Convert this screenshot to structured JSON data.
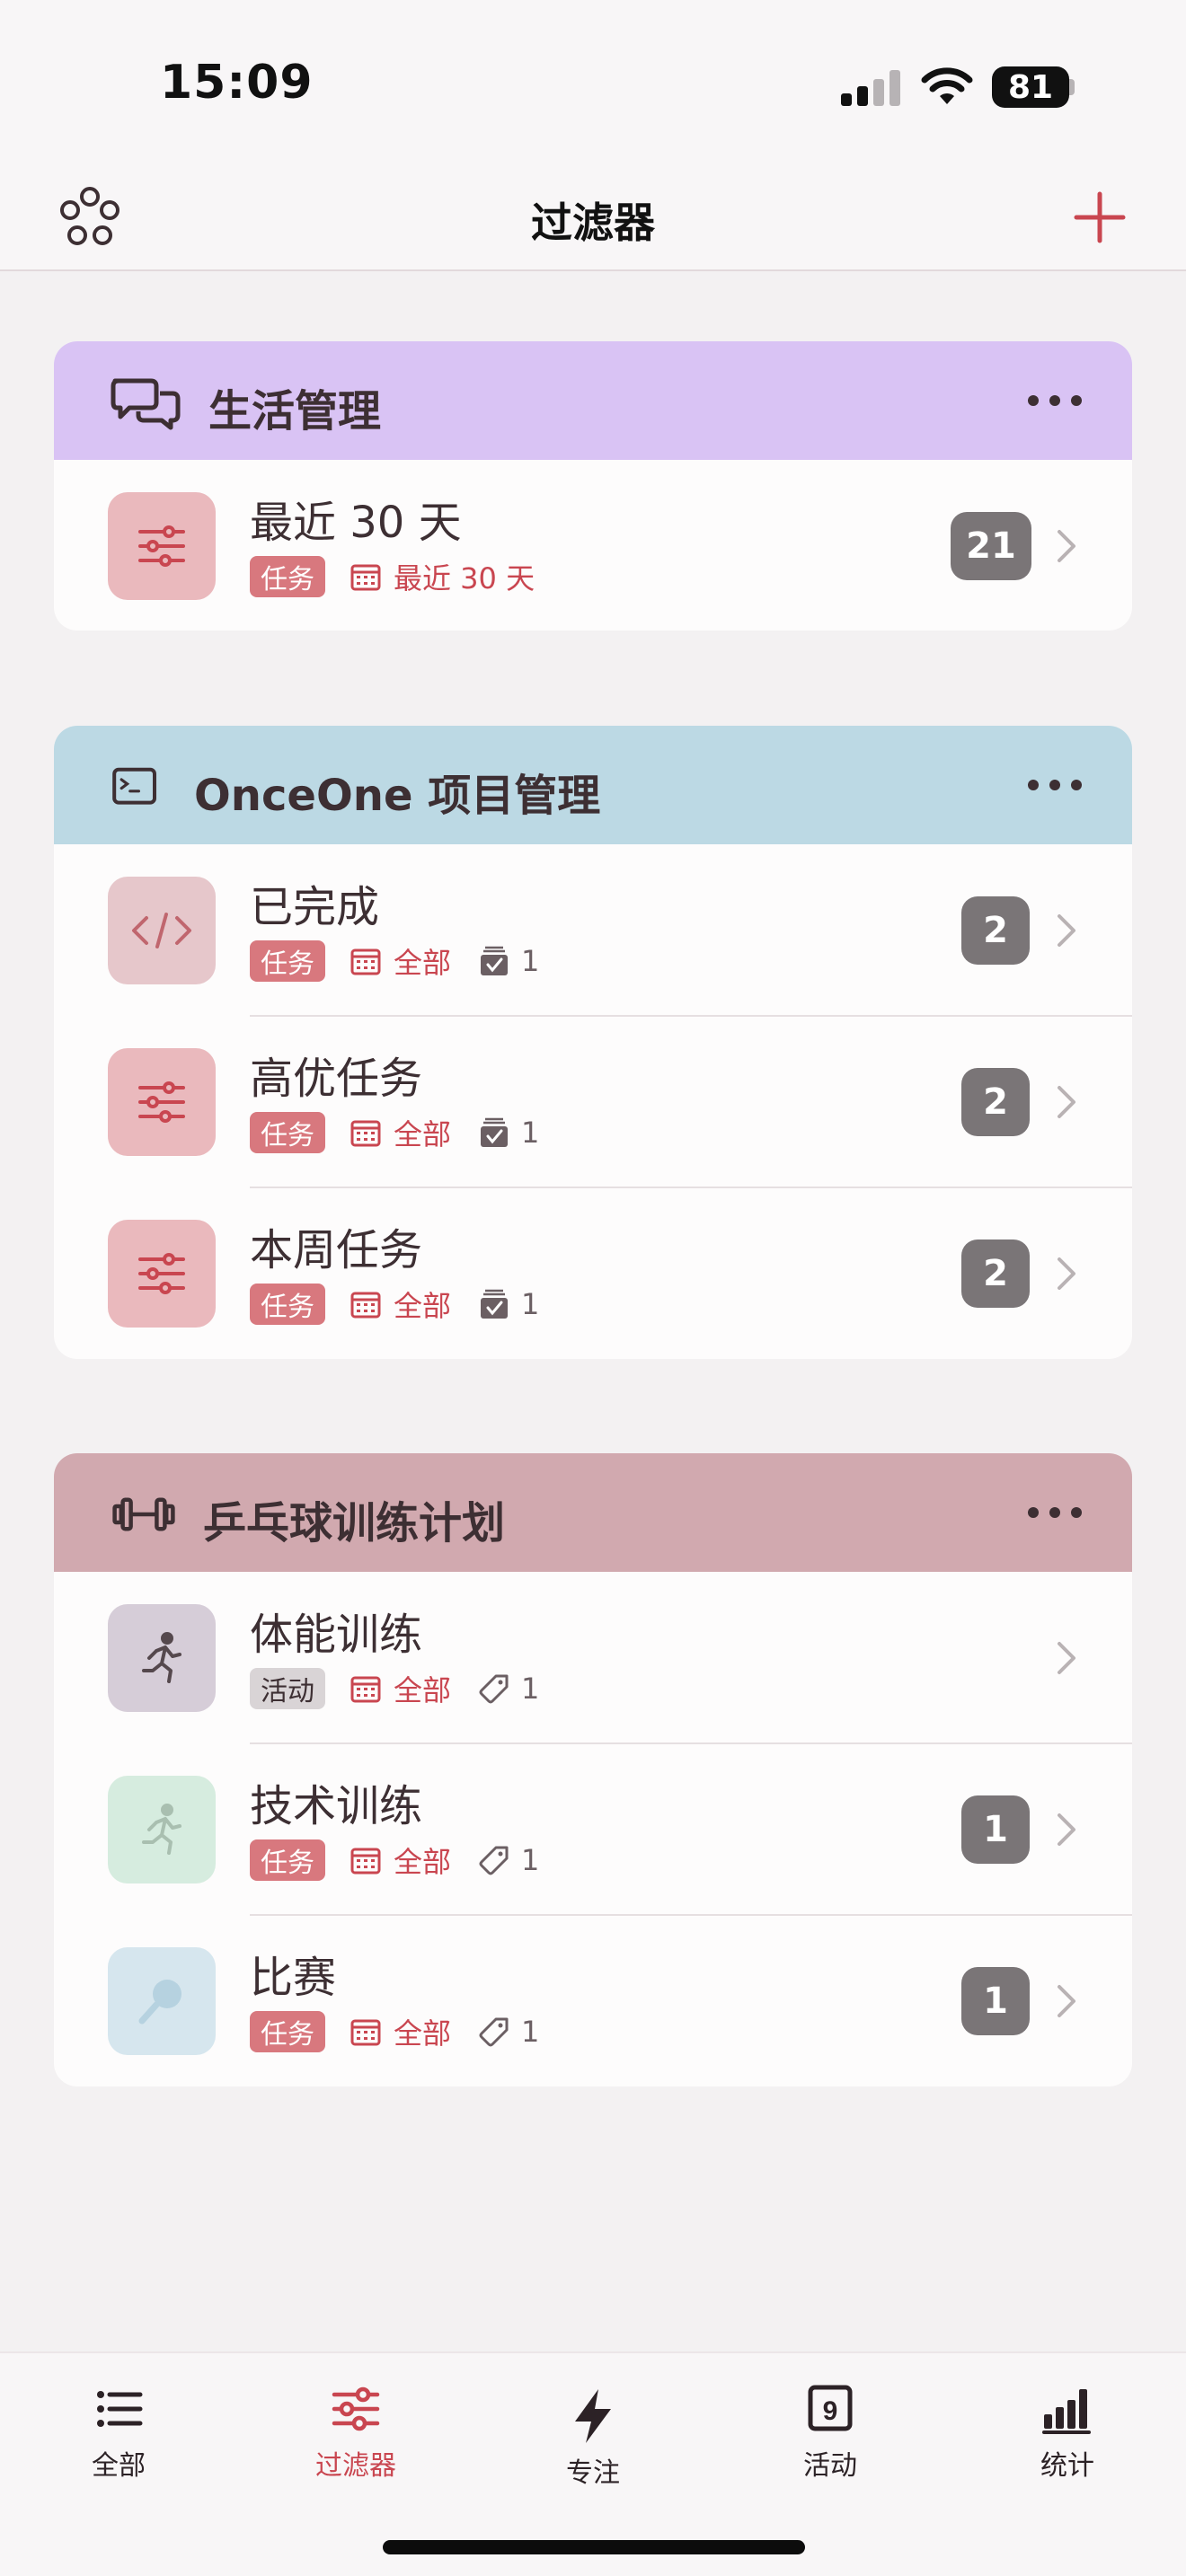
{
  "status_bar": {
    "time": "15:09",
    "battery": "81"
  },
  "nav": {
    "title": "过滤器"
  },
  "colors": {
    "accent": "#c94650",
    "group_life": "#d9c3f4",
    "group_project": "#bcd9e4",
    "group_pingpong": "#d1a9af",
    "badge": "#7a7577",
    "tag_task": "#d8787e"
  },
  "groups": [
    {
      "title": "生活管理",
      "icon": "chat-bubbles-icon",
      "items": [
        {
          "title": "最近 30 天",
          "tag": "任务",
          "date_label": "最近 30 天",
          "count": null,
          "badge": "21",
          "thumb_icon": "sliders-icon"
        }
      ]
    },
    {
      "title": "OnceOne 项目管理",
      "icon": "terminal-icon",
      "items": [
        {
          "title": "已完成",
          "tag": "任务",
          "date_label": "全部",
          "count": "1",
          "badge": "2",
          "thumb_icon": "code-icon"
        },
        {
          "title": "高优任务",
          "tag": "任务",
          "date_label": "全部",
          "count": "1",
          "badge": "2",
          "thumb_icon": "sliders-icon"
        },
        {
          "title": "本周任务",
          "tag": "任务",
          "date_label": "全部",
          "count": "1",
          "badge": "2",
          "thumb_icon": "sliders-icon"
        }
      ]
    },
    {
      "title": "乒乓球训练计划",
      "icon": "dumbbell-icon",
      "items": [
        {
          "title": "体能训练",
          "tag": "活动",
          "date_label": "全部",
          "count": "1",
          "badge": null,
          "thumb_icon": "runner-icon"
        },
        {
          "title": "技术训练",
          "tag": "任务",
          "date_label": "全部",
          "count": "1",
          "badge": "1",
          "thumb_icon": "runner-icon"
        },
        {
          "title": "比赛",
          "tag": "任务",
          "date_label": "全部",
          "count": "1",
          "badge": "1",
          "thumb_icon": "racket-icon"
        }
      ]
    }
  ],
  "tabs": [
    {
      "label": "全部",
      "icon": "list-icon",
      "active": false
    },
    {
      "label": "过滤器",
      "icon": "sliders-icon",
      "active": true
    },
    {
      "label": "专注",
      "icon": "bolt-icon",
      "active": false
    },
    {
      "label": "活动",
      "icon": "calendar-9-icon",
      "active": false,
      "icon_text": "9"
    },
    {
      "label": "统计",
      "icon": "bar-chart-icon",
      "active": false
    }
  ]
}
